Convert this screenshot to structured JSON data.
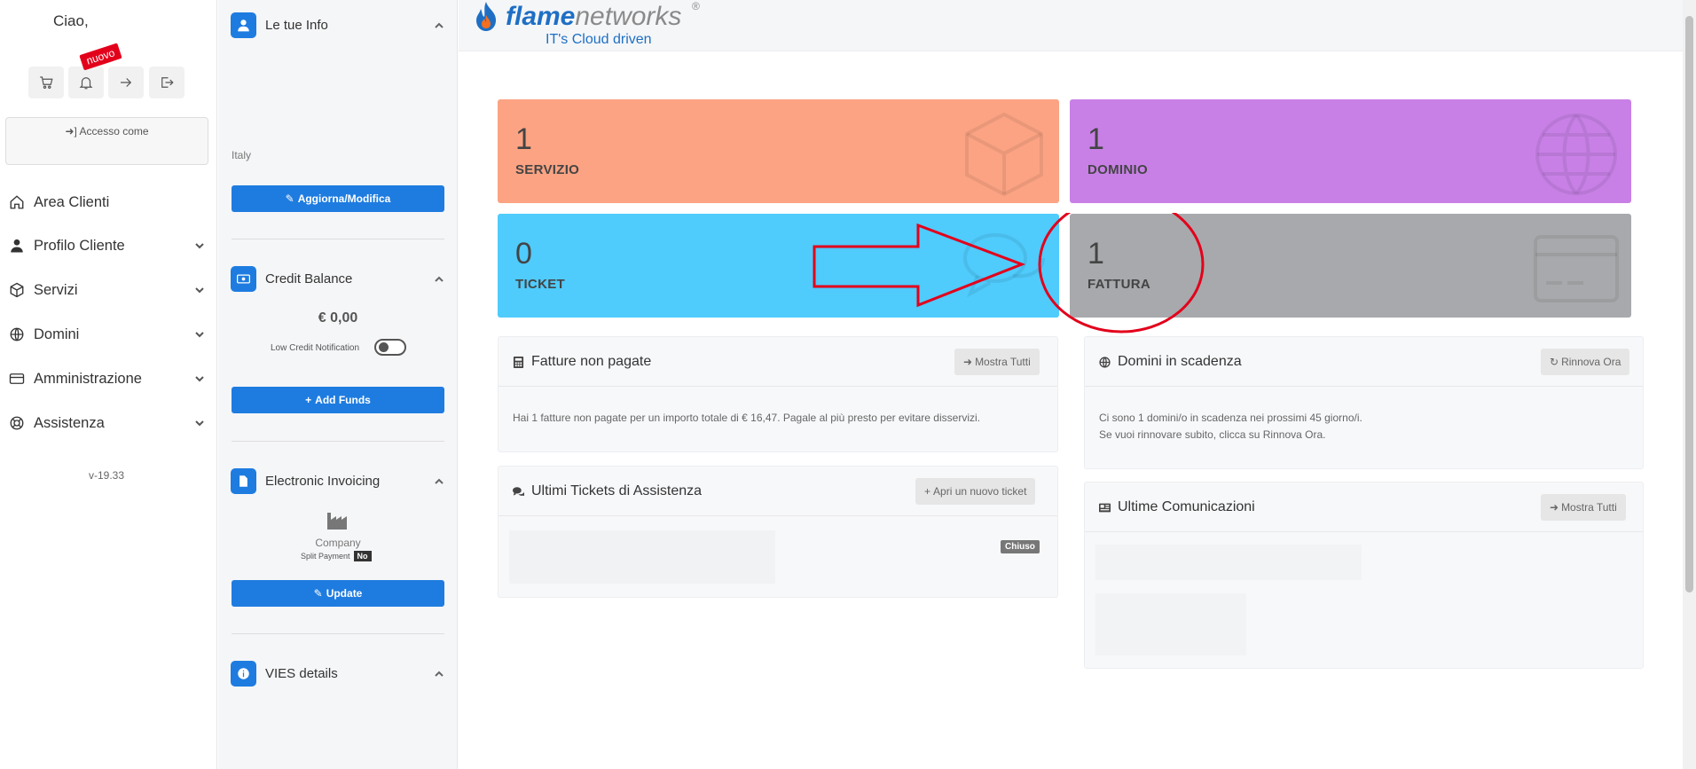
{
  "sidebar": {
    "greeting": "Ciao,",
    "new_badge": "nuovo",
    "accesso_label": "Accesso come",
    "nav": [
      {
        "label": "Area Clienti"
      },
      {
        "label": "Profilo Cliente"
      },
      {
        "label": "Servizi"
      },
      {
        "label": "Domini"
      },
      {
        "label": "Amministrazione"
      },
      {
        "label": "Assistenza"
      }
    ],
    "version": "v-19.33"
  },
  "info_panel": {
    "le_tue_info": {
      "title": "Le tue Info",
      "country": "Italy",
      "button": "Aggiorna/Modifica"
    },
    "credit_balance": {
      "title": "Credit Balance",
      "amount": "€ 0,00",
      "low_credit_label": "Low Credit Notification",
      "low_credit_enabled": false,
      "button": "Add Funds"
    },
    "electronic_invoicing": {
      "title": "Electronic Invoicing",
      "type": "Company",
      "split_payment_label": "Split Payment",
      "split_payment_value": "No",
      "button": "Update"
    },
    "vies": {
      "title": "VIES details"
    }
  },
  "header": {
    "logo_bold": "flame",
    "logo_light": "networks",
    "logo_reg": "®",
    "tagline": "IT's Cloud driven"
  },
  "stats": [
    {
      "count": "1",
      "label": "SERVIZIO",
      "color": "#fba383",
      "icon": "box-icon"
    },
    {
      "count": "1",
      "label": "DOMINIO",
      "color": "#c880e6",
      "icon": "globe-icon"
    },
    {
      "count": "0",
      "label": "TICKET",
      "color": "#4fcbfc",
      "icon": "comments-icon"
    },
    {
      "count": "1",
      "label": "FATTURA",
      "color": "#a7a9ac",
      "icon": "credit-card-icon"
    }
  ],
  "cards": {
    "fatture": {
      "title": "Fatture non pagate",
      "button": "Mostra Tutti",
      "body": "Hai 1 fatture non pagate per un importo totale di € 16,47. Pagale al più presto per evitare disservizi."
    },
    "domini": {
      "title": "Domini in scadenza",
      "button": "Rinnova Ora",
      "body_line1": "Ci sono 1 domini/o in scadenza nei prossimi 45 giorno/i.",
      "body_line2": "Se vuoi rinnovare subito, clicca su Rinnova Ora."
    },
    "tickets": {
      "title": "Ultimi Tickets di Assistenza",
      "button": "Apri un nuovo ticket",
      "ticket_status": "Chiuso"
    },
    "comunicazioni": {
      "title": "Ultime Comunicazioni",
      "button": "Mostra Tutti"
    }
  },
  "annotation": {
    "arrow_color": "#e3001b",
    "circle_color": "#e3001b"
  }
}
